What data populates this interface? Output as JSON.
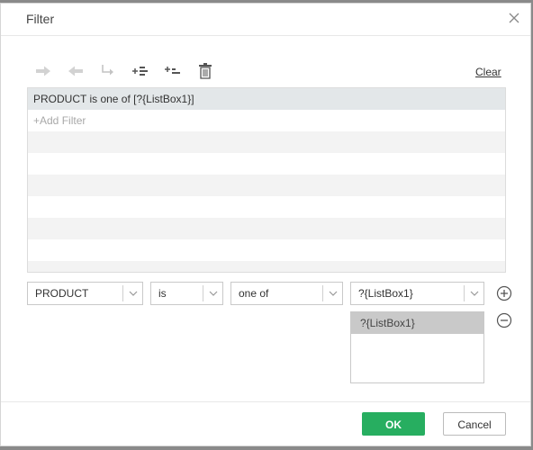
{
  "dialog": {
    "title": "Filter",
    "close_icon": "close-icon"
  },
  "toolbar": {
    "icons": [
      "arrow-right-icon",
      "arrow-left-icon",
      "return-arrow-icon",
      "insert-condition-above-icon",
      "insert-condition-below-icon",
      "trash-icon"
    ],
    "clear_label": "Clear"
  },
  "filter_list": {
    "rows": [
      "PRODUCT is one of [?{ListBox1}]",
      "+Add Filter",
      "",
      "",
      "",
      "",
      "",
      "",
      ""
    ]
  },
  "condition": {
    "field": "PRODUCT",
    "operator": "is",
    "comparison": "one of",
    "value": "?{ListBox1}"
  },
  "values": {
    "items": [
      "?{ListBox1}"
    ]
  },
  "footer": {
    "ok_label": "OK",
    "cancel_label": "Cancel"
  },
  "colors": {
    "ok_green": "#27ae60",
    "selected_row": "#e3e7e9",
    "stripe": "#f3f3f3"
  }
}
